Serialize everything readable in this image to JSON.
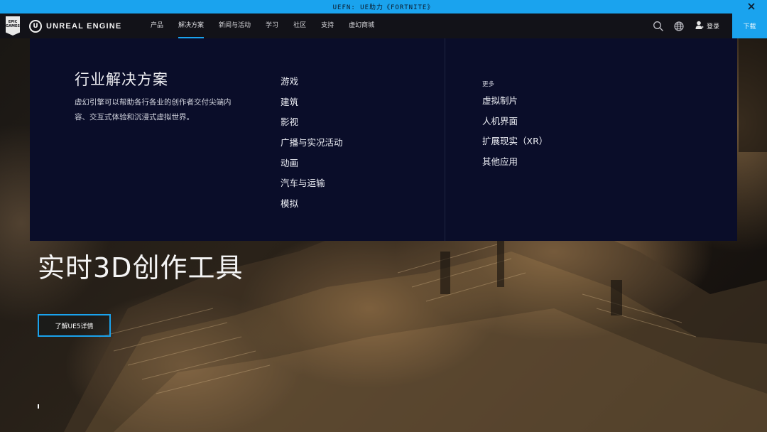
{
  "announcement": {
    "text": "UEFN: UE助力《FORTNITE》"
  },
  "topnav": {
    "epic_logo": "EPIC GAMES",
    "brand": "UNREAL ENGINE",
    "brand_mark": "U",
    "items": [
      {
        "label": "产品",
        "active": false
      },
      {
        "label": "解决方案",
        "active": true
      },
      {
        "label": "新闻与活动",
        "active": false
      },
      {
        "label": "学习",
        "active": false
      },
      {
        "label": "社区",
        "active": false
      },
      {
        "label": "支持",
        "active": false
      },
      {
        "label": "虚幻商城",
        "active": false
      }
    ],
    "login": "登录",
    "download": "下载",
    "icons": [
      "search-icon",
      "globe-icon",
      "user-icon"
    ]
  },
  "mega_menu": {
    "title": "行业解决方案",
    "description": "虚幻引擎可以帮助各行各业的创作者交付尖端内容、交互式体验和沉浸式虚拟世界。",
    "industries": [
      "游戏",
      "建筑",
      "影视",
      "广播与实况活动",
      "动画",
      "汽车与运输",
      "模拟"
    ],
    "more_label": "更多",
    "more_items": [
      "虚拟制片",
      "人机界面",
      "扩展现实（XR）",
      "其他应用"
    ]
  },
  "hero": {
    "title": "实时3D创作工具",
    "button": "了解UE5详情"
  },
  "colors": {
    "accent": "#1aa3ee",
    "nav_bg": "#121218",
    "menu_bg": "#0a0d29"
  }
}
